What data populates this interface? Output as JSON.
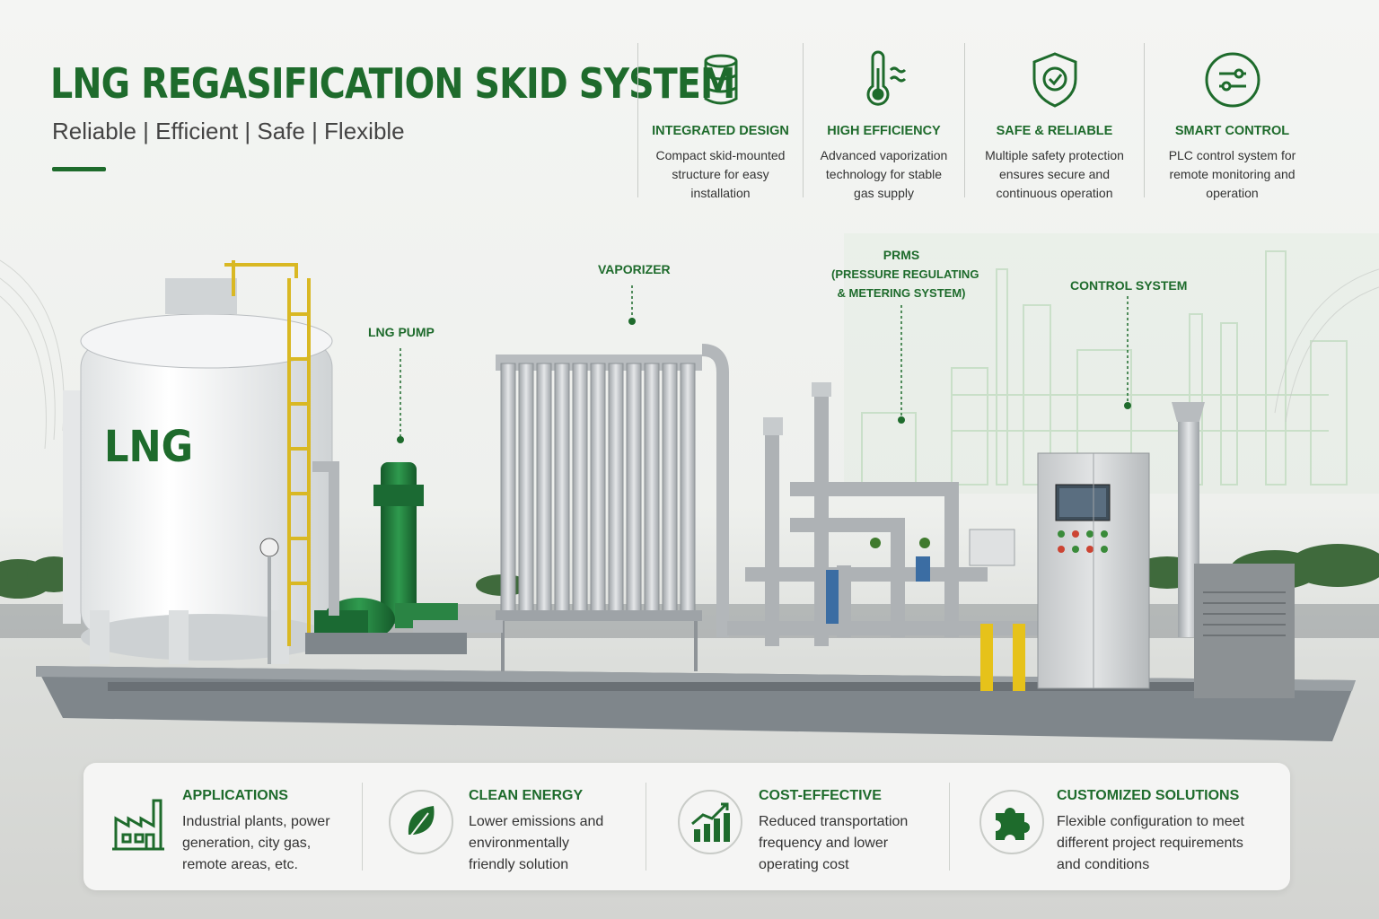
{
  "header": {
    "title": "LNG REGASIFICATION SKID SYSTEM",
    "subtitle": "Reliable | Efficient | Safe | Flexible"
  },
  "features": [
    {
      "icon": "storage-tank-icon",
      "title": "INTEGRATED DESIGN",
      "lines": [
        "Compact skid-mounted",
        "structure for easy",
        "installation"
      ]
    },
    {
      "icon": "thermometer-icon",
      "title": "HIGH EFFICIENCY",
      "lines": [
        "Advanced vaporization",
        "technology for stable",
        "gas supply"
      ]
    },
    {
      "icon": "shield-check-icon",
      "title": "SAFE & RELIABLE",
      "lines": [
        "Multiple safety protection",
        "ensures secure and",
        "continuous operation"
      ]
    },
    {
      "icon": "control-sliders-icon",
      "title": "SMART CONTROL",
      "lines": [
        "PLC control system for",
        "remote monitoring and",
        "operation"
      ]
    }
  ],
  "callouts": {
    "lng_pump": "LNG PUMP",
    "vaporizer": "VAPORIZER",
    "prms_title": "PRMS",
    "prms_line1": "(PRESSURE REGULATING",
    "prms_line2": "& METERING SYSTEM)",
    "control_system": "CONTROL SYSTEM"
  },
  "tank_label": "LNG",
  "benefits": [
    {
      "icon": "factory-icon",
      "title": "APPLICATIONS",
      "lines": [
        "Industrial plants, power",
        "generation, city gas,",
        "remote areas, etc."
      ]
    },
    {
      "icon": "leaf-icon",
      "title": "CLEAN ENERGY",
      "lines": [
        "Lower emissions and",
        "environmentally",
        "friendly solution"
      ]
    },
    {
      "icon": "bar-chart-growth-icon",
      "title": "COST-EFFECTIVE",
      "lines": [
        "Reduced transportation",
        "frequency and lower",
        "operating cost"
      ]
    },
    {
      "icon": "puzzle-piece-icon",
      "title": "CUSTOMIZED SOLUTIONS",
      "lines": [
        "Flexible configuration to meet",
        "different project requirements",
        "and conditions"
      ]
    }
  ],
  "colors": {
    "brand_green": "#1e6b2c",
    "pump_green": "#1f7a3a",
    "steel": "#b9bdc0",
    "safety_yellow": "#e6c21a",
    "ground": "#d3d4d1"
  }
}
